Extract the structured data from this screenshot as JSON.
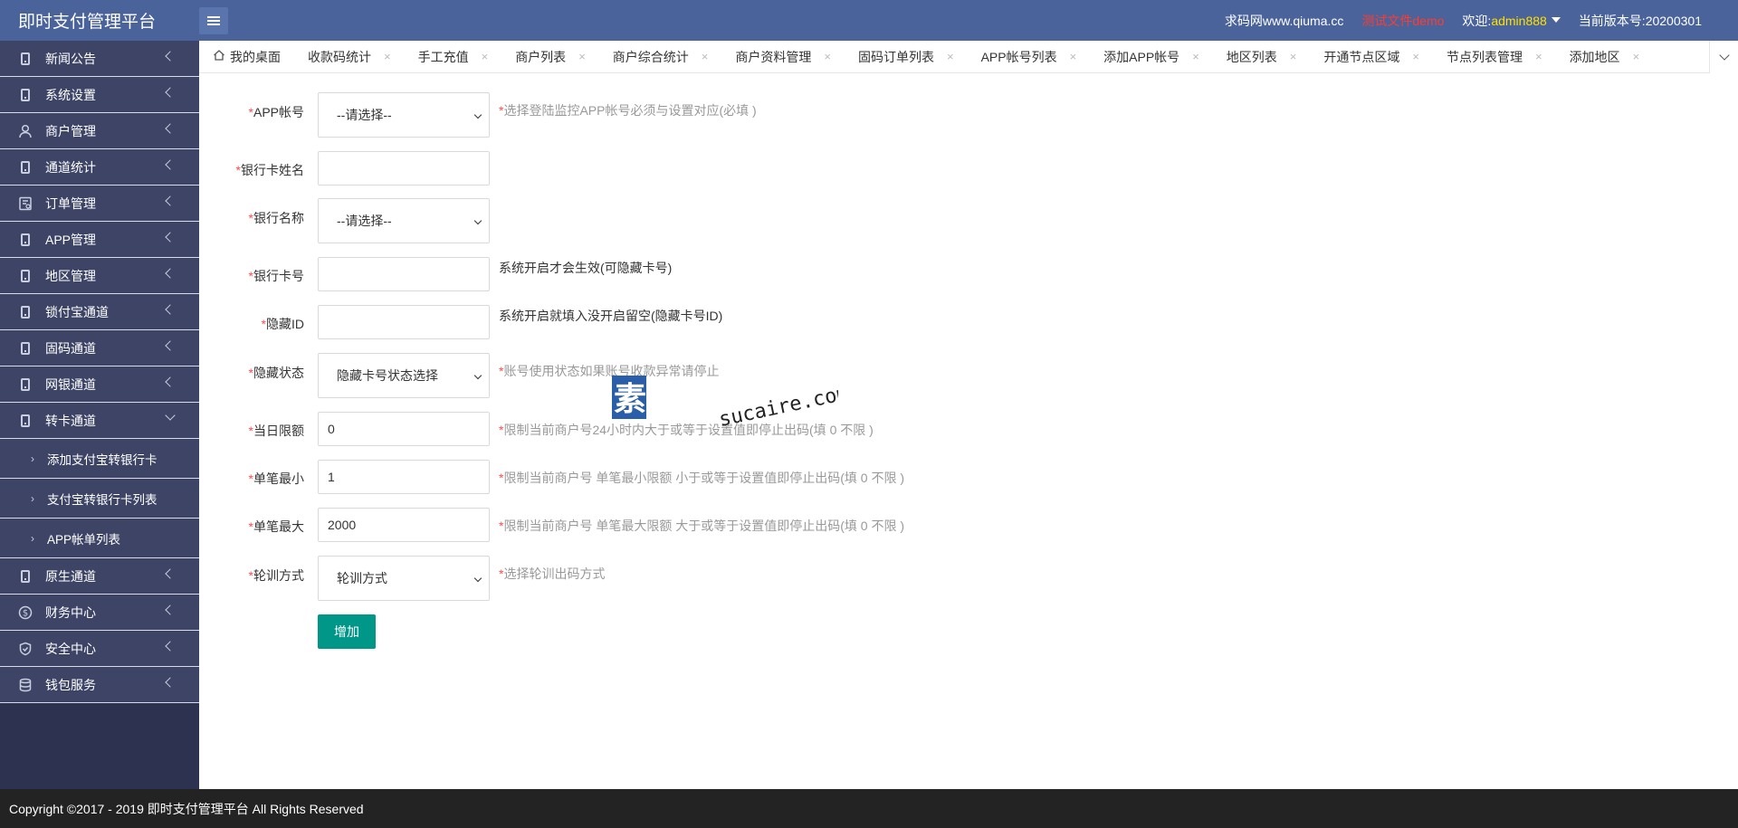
{
  "header": {
    "brand": "即时支付管理平台",
    "site": "求码网www.qiuma.cc",
    "test_label": "测试文件demo",
    "welcome_prefix": "欢迎:",
    "username": "admin888",
    "version_label": "当前版本号:20200301",
    "colors": {
      "bg": "#4a639b",
      "username": "#ffe100",
      "test": "#ff3b30"
    }
  },
  "sidebar": {
    "items": [
      {
        "label": "新闻公告",
        "icon": "phone-icon"
      },
      {
        "label": "系统设置",
        "icon": "phone-icon"
      },
      {
        "label": "商户管理",
        "icon": "user-icon"
      },
      {
        "label": "通道统计",
        "icon": "phone-icon"
      },
      {
        "label": "订单管理",
        "icon": "order-icon"
      },
      {
        "label": "APP管理",
        "icon": "phone-icon"
      },
      {
        "label": "地区管理",
        "icon": "phone-icon"
      },
      {
        "label": "锁付宝通道",
        "icon": "phone-icon"
      },
      {
        "label": "固码通道",
        "icon": "phone-icon"
      },
      {
        "label": "网银通道",
        "icon": "phone-icon"
      },
      {
        "label": "转卡通道",
        "icon": "phone-icon",
        "open": true
      }
    ],
    "sub_items": [
      {
        "label": "添加支付宝转银行卡"
      },
      {
        "label": "支付宝转银行卡列表"
      },
      {
        "label": "APP帐单列表"
      }
    ],
    "items_after": [
      {
        "label": "原生通道",
        "icon": "phone-icon"
      },
      {
        "label": "财务中心",
        "icon": "dollar-icon"
      },
      {
        "label": "安全中心",
        "icon": "shield-icon"
      },
      {
        "label": "钱包服务",
        "icon": "database-icon"
      }
    ]
  },
  "tabs": [
    {
      "label": "我的桌面",
      "home": true
    },
    {
      "label": "收款码统计"
    },
    {
      "label": "手工充值"
    },
    {
      "label": "商户列表"
    },
    {
      "label": "商户综合统计"
    },
    {
      "label": "商户资料管理"
    },
    {
      "label": "固码订单列表"
    },
    {
      "label": "APP帐号列表"
    },
    {
      "label": "添加APP帐号"
    },
    {
      "label": "地区列表"
    },
    {
      "label": "开通节点区域"
    },
    {
      "label": "节点列表管理"
    },
    {
      "label": "添加地区"
    }
  ],
  "form": {
    "app_account": {
      "label": "APP帐号",
      "value": "--请选择--",
      "hint": "选择登陆监控APP帐号必须与设置对应(必填 )"
    },
    "card_name": {
      "label": "银行卡姓名",
      "value": ""
    },
    "bank_name": {
      "label": "银行名称",
      "value": "--请选择--"
    },
    "card_number": {
      "label": "银行卡号",
      "value": "",
      "hint": "系统开启才会生效(可隐藏卡号)"
    },
    "hidden_id": {
      "label": "隐藏ID",
      "value": "",
      "hint": "系统开启就填入没开启留空(隐藏卡号ID)"
    },
    "hidden_status": {
      "label": "隐藏状态",
      "value": "隐藏卡号状态选择",
      "hint": "账号使用状态如果账号收款异常请停止"
    },
    "daily_limit": {
      "label": "当日限额",
      "value": "0",
      "hint": "限制当前商户号24小时内大于或等于设置值即停止出码(填 0 不限 )"
    },
    "min_single": {
      "label": "单笔最小",
      "value": "1",
      "hint": "限制当前商户号 单笔最小限额 小于或等于设置值即停止出码(填 0 不限 )"
    },
    "max_single": {
      "label": "单笔最大",
      "value": "2000",
      "hint": "限制当前商户号 单笔最大限额 大于或等于设置值即停止出码(填 0 不限 )"
    },
    "rotation": {
      "label": "轮训方式",
      "value": "轮训方式",
      "hint": "选择轮训出码方式"
    },
    "submit_label": "增加",
    "required_mark": "*"
  },
  "watermark": {
    "cn": "素材熱",
    "en": "sucaire.com"
  },
  "footer": {
    "copyright": "Copyright ©2017 - 2019 即时支付管理平台 All Rights Reserved"
  }
}
